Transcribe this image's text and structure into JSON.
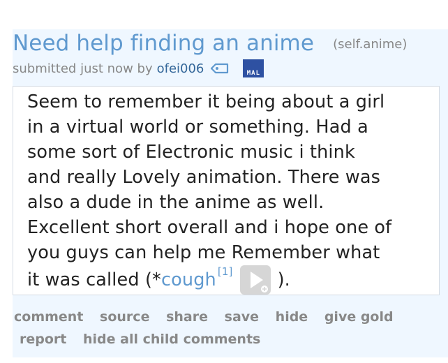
{
  "post": {
    "title": "Need help finding an anime",
    "domain": "(self.anime)",
    "tagline": {
      "prefix": "submitted just now by",
      "author": "ofei006",
      "mal_badge": "MAL"
    },
    "body": {
      "lines": [
        "Seem to remember it being about a girl",
        "in a virtual world or something. Had a",
        "some sort of Electronic music i think",
        "and really Lovely animation. There was",
        "also a dude in the anime as well.",
        "Excellent short overall and i hope one of",
        "you guys can help me Remember what"
      ],
      "last_line_prefix": "it was called (*",
      "link_text": "cough",
      "footnote": "[1]",
      "last_line_suffix": ")."
    },
    "buttons_row1": [
      "comment",
      "source",
      "share",
      "save",
      "hide",
      "give gold"
    ],
    "buttons_row2": [
      "report",
      "hide all child comments"
    ]
  },
  "colors": {
    "title": "#5f99cf",
    "muted": "#888888",
    "author": "#336699",
    "post_bg": "#eff7ff",
    "mal_badge": "#2e51a2"
  },
  "icons": [
    "tag-icon",
    "play-button-icon"
  ]
}
